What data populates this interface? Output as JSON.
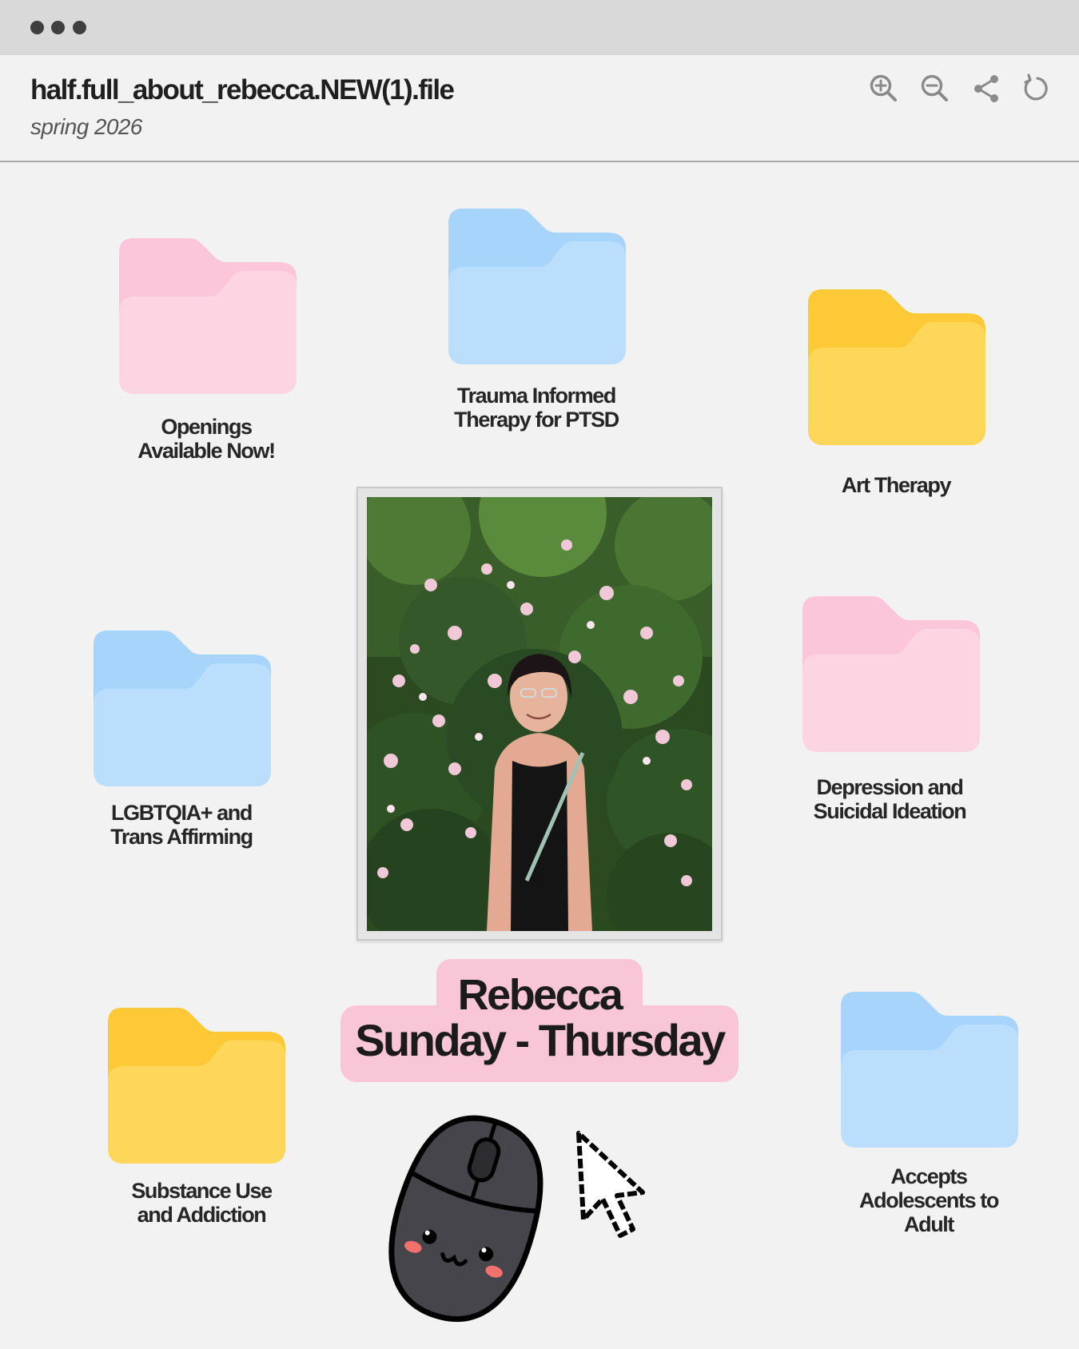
{
  "window": {
    "title": "half.full_about_rebecca.NEW(1).file",
    "subtitle": "spring 2026",
    "toolbar": [
      {
        "icon": "zoom-in-icon"
      },
      {
        "icon": "zoom-out-icon"
      },
      {
        "icon": "share-icon"
      },
      {
        "icon": "refresh-icon"
      }
    ]
  },
  "folders": [
    {
      "label_lines": [
        "Openings",
        "Available Now!"
      ],
      "color": "pink"
    },
    {
      "label_lines": [
        "Trauma Informed",
        "Therapy for PTSD"
      ],
      "color": "blue"
    },
    {
      "label_lines": [
        "Art Therapy"
      ],
      "color": "yellow"
    },
    {
      "label_lines": [
        "LGBTQIA+ and",
        "Trans Affirming"
      ],
      "color": "blue"
    },
    {
      "label_lines": [
        "Depression and",
        "Suicidal Ideation"
      ],
      "color": "pink"
    },
    {
      "label_lines": [
        "Substance Use",
        "and Addiction"
      ],
      "color": "yellow"
    },
    {
      "label_lines": [
        "Accepts",
        "Adolescents to",
        "Adult"
      ],
      "color": "blue"
    }
  ],
  "profile": {
    "name": "Rebecca",
    "schedule": "Sunday - Thursday"
  },
  "colors": {
    "pink_back": "#fcc6da",
    "pink_front": "#fdd4e2",
    "blue_back": "#a6d4fb",
    "blue_front": "#badefc",
    "yellow_back": "#fdc936",
    "yellow_front": "#fed659",
    "name_pill": "#f9c6d7",
    "titlebar": "#d9d9d9",
    "background": "#f2f2f2"
  }
}
